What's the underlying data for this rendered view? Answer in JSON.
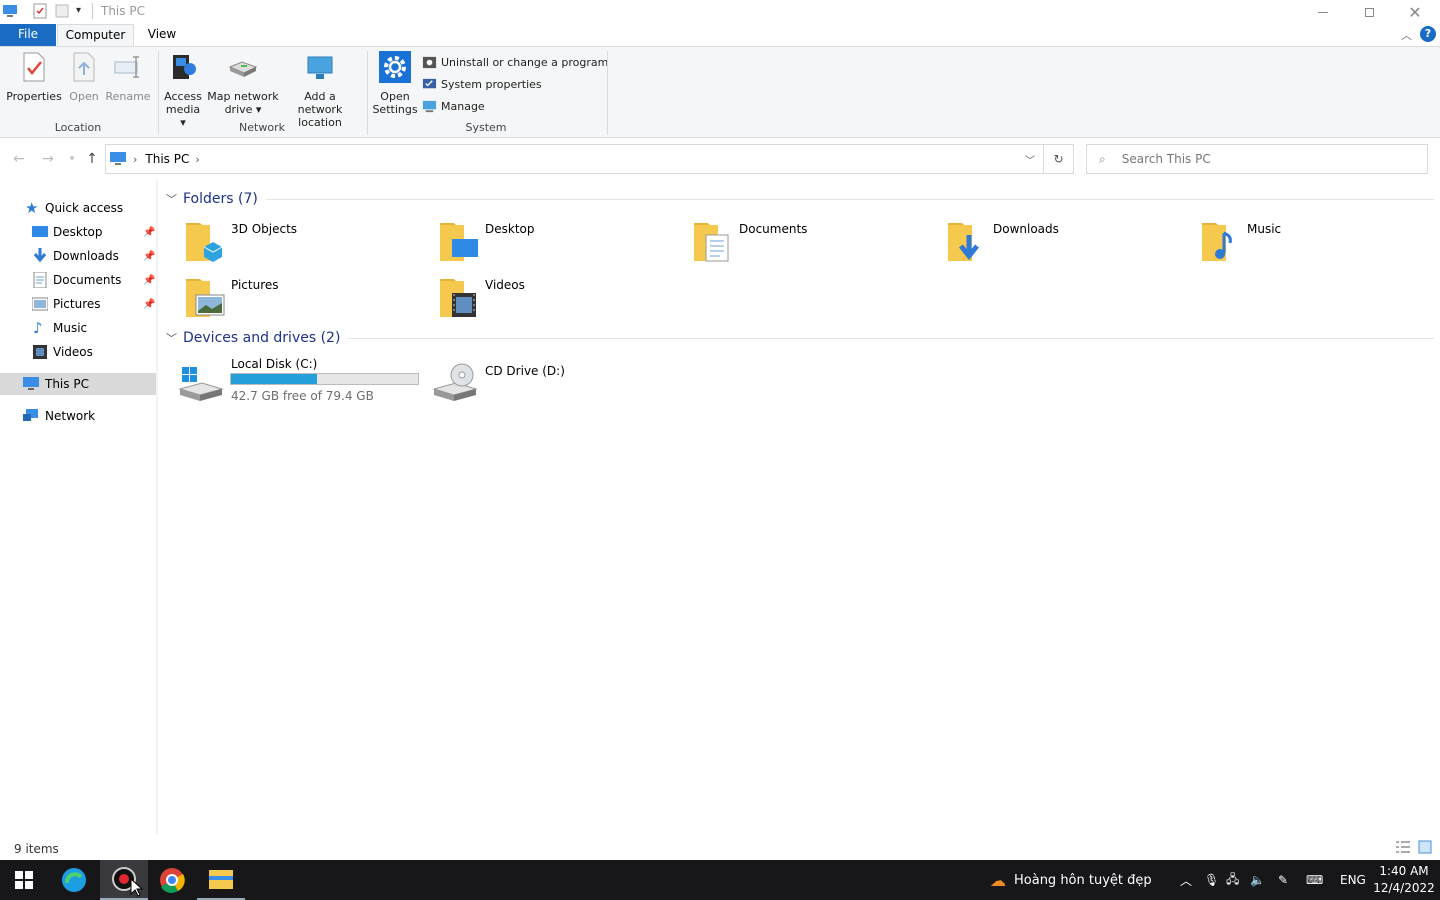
{
  "window": {
    "title": "This PC"
  },
  "tabs": {
    "file": "File",
    "computer": "Computer",
    "view": "View"
  },
  "ribbon": {
    "properties": "Properties",
    "open": "Open",
    "rename": "Rename",
    "location_group": "Location",
    "access_media_1": "Access",
    "access_media_2": "media ▾",
    "map_drive_1": "Map network",
    "map_drive_2": "drive ▾",
    "add_location_1": "Add a network",
    "add_location_2": "location",
    "network_group": "Network",
    "open_settings_1": "Open",
    "open_settings_2": "Settings",
    "uninstall": "Uninstall or change a program",
    "system_properties": "System properties",
    "manage": "Manage",
    "system_group": "System"
  },
  "address": {
    "crumb": "This PC",
    "search_placeholder": "Search This PC"
  },
  "sidebar": {
    "quick_access": "Quick access",
    "items": [
      {
        "label": "Desktop",
        "pinned": true
      },
      {
        "label": "Downloads",
        "pinned": true
      },
      {
        "label": "Documents",
        "pinned": true
      },
      {
        "label": "Pictures",
        "pinned": true
      },
      {
        "label": "Music",
        "pinned": false
      },
      {
        "label": "Videos",
        "pinned": false
      }
    ],
    "this_pc": "This PC",
    "network": "Network"
  },
  "main": {
    "folders_header": "Folders (7)",
    "folders": [
      "3D Objects",
      "Desktop",
      "Documents",
      "Downloads",
      "Music",
      "Pictures",
      "Videos"
    ],
    "drives_header": "Devices and drives (2)",
    "drives": [
      {
        "name": "Local Disk (C:)",
        "free": "42.7 GB free of 79.4 GB",
        "used_fraction": 0.46
      },
      {
        "name": "CD Drive (D:)"
      }
    ]
  },
  "status": {
    "items": "9 items"
  },
  "taskbar": {
    "weather": "Hoàng hôn tuyệt đẹp",
    "lang": "ENG",
    "time": "1:40 AM",
    "date": "12/4/2022"
  },
  "colors": {
    "accent": "#1a6bc4",
    "folder": "#f5c94e",
    "selection": "#d9d9d9",
    "drive_bar": "#26a0da"
  }
}
